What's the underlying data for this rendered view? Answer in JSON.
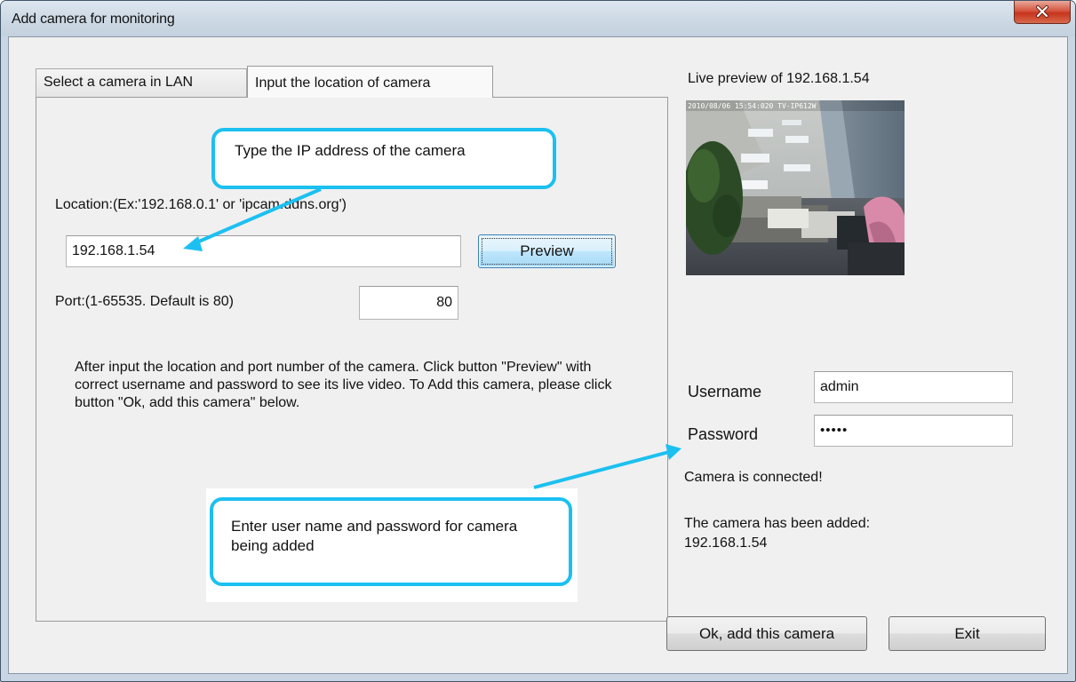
{
  "window": {
    "title": "Add camera for monitoring"
  },
  "tabs": [
    {
      "label": "Select a camera in LAN"
    },
    {
      "label": "Input the location of camera"
    }
  ],
  "form": {
    "location_label": "Location:(Ex:'192.168.0.1' or 'ipcam.ddns.org')",
    "location_value": "192.168.1.54",
    "preview_button": "Preview",
    "port_label": "Port:(1-65535. Default is 80)",
    "port_value": "80",
    "instructions": "After input the location and port number of the camera. Click button \"Preview\" with correct username and password to see its live video. To Add this camera, please click button \"Ok, add this camera\" below."
  },
  "callouts": {
    "ip_hint": "Type the IP address of the camera",
    "user_hint": "Enter user name and password for camera being added"
  },
  "preview": {
    "title": "Live preview of 192.168.1.54",
    "overlay_text": "2010/08/06 15:54:020 TV-IP612W"
  },
  "credentials": {
    "username_label": "Username",
    "username_value": "admin",
    "password_label": "Password",
    "password_value": "•••••"
  },
  "status": {
    "connected": "Camera is connected!",
    "added_line1": "The camera has been added:",
    "added_line2": "192.168.1.54"
  },
  "buttons": {
    "ok": "Ok, add this camera",
    "exit": "Exit"
  },
  "colors": {
    "callout_border": "#1cc0f0",
    "close_button": "#c7341c"
  }
}
